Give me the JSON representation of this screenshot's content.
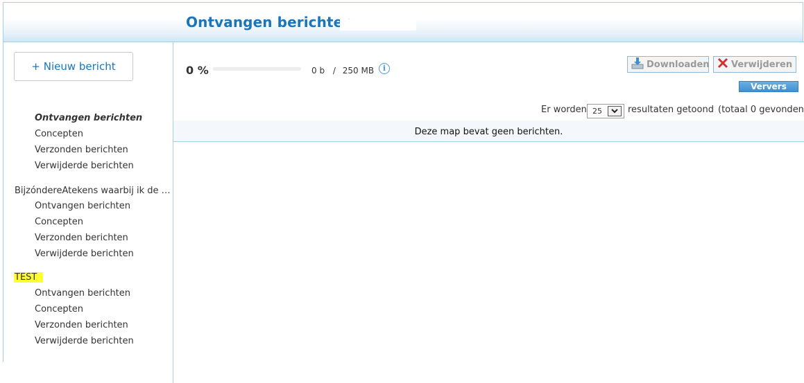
{
  "header": {
    "title": "Ontvangen berichten -"
  },
  "sidebar": {
    "new_message_label": "+ Nieuw bericht",
    "folders": [
      {
        "label": "Ontvangen berichten"
      },
      {
        "label": "Concepten"
      },
      {
        "label": "Verzonden berichten"
      },
      {
        "label": "Verwijderde berichten"
      }
    ],
    "groups": [
      {
        "label": "BijzóndereAtekens waarbij ik de n...",
        "items": [
          {
            "label": "Ontvangen berichten"
          },
          {
            "label": "Concepten"
          },
          {
            "label": "Verzonden berichten"
          },
          {
            "label": "Verwijderde berichten"
          }
        ]
      },
      {
        "label": "TEST",
        "highlight_color": "#ffff33",
        "items": [
          {
            "label": "Ontvangen berichten"
          },
          {
            "label": "Concepten"
          },
          {
            "label": "Verzonden berichten"
          },
          {
            "label": "Verwijderde berichten"
          }
        ]
      }
    ]
  },
  "quota": {
    "percent_label": "0 %",
    "used": "0 b",
    "separator": "/",
    "total": "250 MB",
    "fraction": 0
  },
  "toolbar": {
    "download_label": "Downloaden",
    "delete_label": "Verwijderen",
    "refresh_label": "Ververs",
    "download_icon": "download-icon",
    "delete_icon": "delete-x-icon"
  },
  "results": {
    "prefix": "Er worden",
    "per_page": "25",
    "suffix": "resultaten getoond",
    "total": "(totaal 0 gevonden)"
  },
  "empty_message": "Deze map bevat geen berichten.",
  "colors": {
    "accent": "#1a75bb",
    "border": "#a9cce3",
    "highlight": "#ffff33",
    "delete_icon": "#d03030"
  }
}
